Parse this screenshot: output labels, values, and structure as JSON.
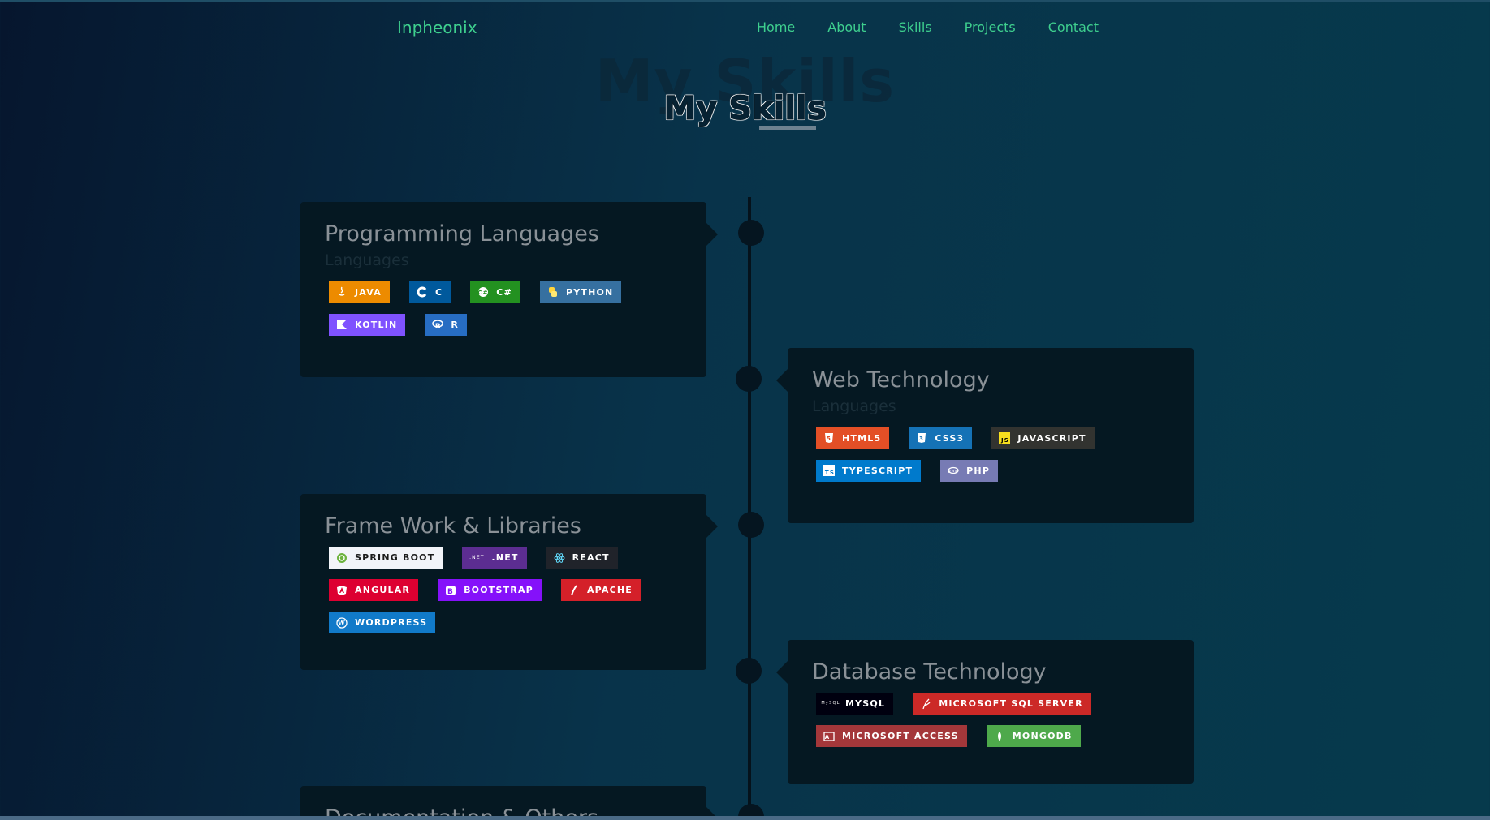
{
  "nav": {
    "brand": "Inpheonix",
    "links": [
      "Home",
      "About",
      "Skills",
      "Projects",
      "Contact"
    ]
  },
  "page": {
    "title_bg": "My Skills",
    "title": "My Skills"
  },
  "sections": [
    {
      "title": "Programming Languages",
      "subtitle": "Languages",
      "badges": [
        {
          "label": "JAVA",
          "color": "#ed8b00",
          "icon": "java-icon"
        },
        {
          "label": "C",
          "color": "#00599c",
          "icon": "c-icon"
        },
        {
          "label": "C#",
          "color": "#239120",
          "icon": "csharp-icon"
        },
        {
          "label": "PYTHON",
          "color": "#3670a0",
          "icon": "python-icon"
        },
        {
          "label": "KOTLIN",
          "color": "#7f52ff",
          "icon": "kotlin-icon"
        },
        {
          "label": "R",
          "color": "#276dc3",
          "icon": "r-icon"
        }
      ]
    },
    {
      "title": "Web Technology",
      "subtitle": "Languages",
      "badges": [
        {
          "label": "HTML5",
          "color": "#e34f26",
          "icon": "html5-icon"
        },
        {
          "label": "CSS3",
          "color": "#1572b6",
          "icon": "css3-icon"
        },
        {
          "label": "JAVASCRIPT",
          "color": "#323330",
          "icon": "javascript-icon"
        },
        {
          "label": "TYPESCRIPT",
          "color": "#007acc",
          "icon": "typescript-icon"
        },
        {
          "label": "PHP",
          "color": "#777bb4",
          "icon": "php-icon"
        }
      ]
    },
    {
      "title": "Frame Work & Libraries",
      "badges": [
        {
          "label": "SPRING BOOT",
          "color": "#f2f4f9",
          "icon": "spring-icon"
        },
        {
          "label": ".NET",
          "color": "#5c2d91",
          "icon": "dotnet-icon"
        },
        {
          "label": "REACT",
          "color": "#20232a",
          "icon": "react-icon"
        },
        {
          "label": "ANGULAR",
          "color": "#dd0031",
          "icon": "angular-icon"
        },
        {
          "label": "BOOTSTRAP",
          "color": "#8511fa",
          "icon": "bootstrap-icon"
        },
        {
          "label": "APACHE",
          "color": "#d42029",
          "icon": "apache-icon"
        },
        {
          "label": "WORDPRESS",
          "color": "#117ac9",
          "icon": "wordpress-icon"
        }
      ]
    },
    {
      "title": "Database Technology",
      "badges": [
        {
          "label": "MYSQL",
          "color": "#00000f",
          "icon": "mysql-icon"
        },
        {
          "label": "MICROSOFT SQL SERVER",
          "color": "#cc2927",
          "icon": "sqlserver-icon"
        },
        {
          "label": "MICROSOFT ACCESS",
          "color": "#a4373a",
          "icon": "access-icon"
        },
        {
          "label": "MONGODB",
          "color": "#4ea94b",
          "icon": "mongodb-icon"
        }
      ]
    },
    {
      "title": "Documentation & Others"
    }
  ]
}
